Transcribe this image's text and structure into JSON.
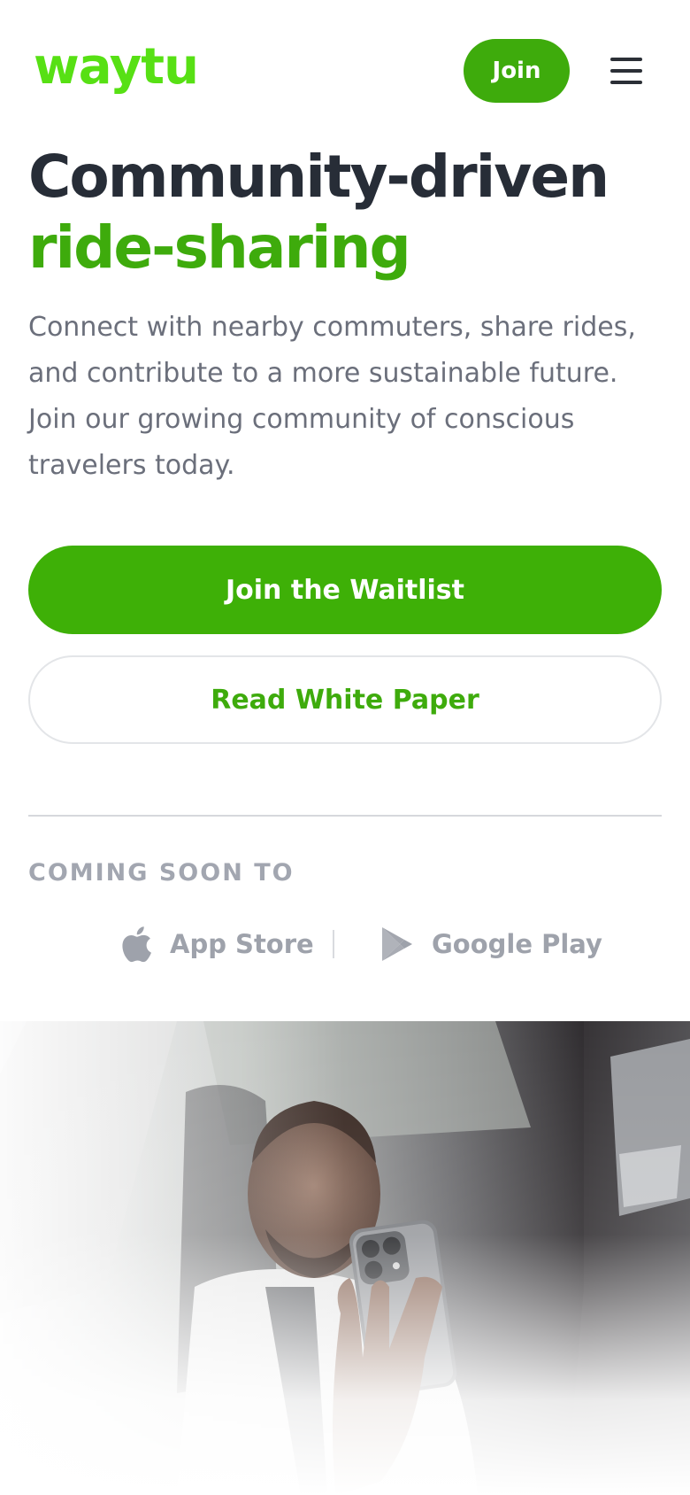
{
  "header": {
    "logo_text": "waytu",
    "join_label": "Join"
  },
  "hero": {
    "title_line1": "Community-driven",
    "title_line2": "ride-sharing",
    "description": "Connect with nearby commuters, share rides, and contribute to a more sustainable future. Join our growing community of conscious travelers today."
  },
  "actions": {
    "primary_label": "Join the Waitlist",
    "secondary_label": "Read White Paper"
  },
  "availability": {
    "heading": "COMING SOON TO",
    "stores": [
      {
        "label": "App Store",
        "icon": "apple-icon"
      },
      {
        "label": "Google Play",
        "icon": "google-play-icon"
      }
    ]
  },
  "colors": {
    "brand_green": "#3eab0c",
    "logo_green": "#57e014",
    "heading_dark": "#272d37",
    "muted_text": "#6b6f7b"
  }
}
